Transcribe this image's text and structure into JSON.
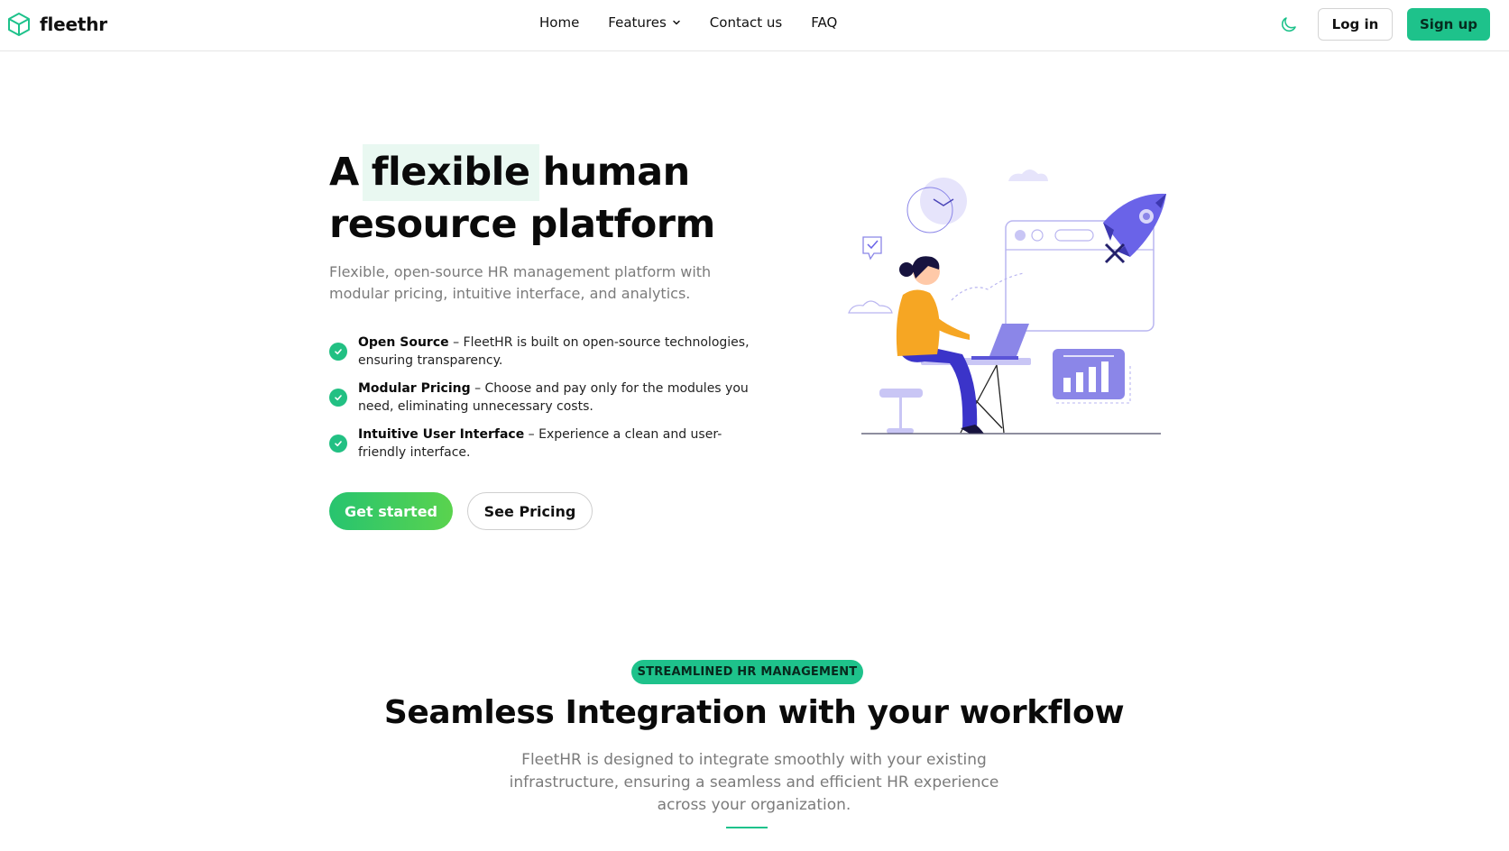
{
  "brand": {
    "name": "fleethr",
    "accent": "#1ec28b",
    "logo_icon": "cube-icon"
  },
  "nav": {
    "items": [
      {
        "label": "Home"
      },
      {
        "label": "Features",
        "icon": "chevron-down-icon"
      },
      {
        "label": "Contact us"
      },
      {
        "label": "FAQ"
      }
    ]
  },
  "header": {
    "theme_toggle_icon": "moon-icon",
    "login_label": "Log in",
    "signup_label": "Sign up"
  },
  "hero": {
    "title_pre": "A",
    "title_highlight": "flexible",
    "title_post": "human resource platform",
    "subtitle": "Flexible, open-source HR management platform with modular pricing, intuitive interface, and analytics.",
    "features": [
      {
        "title": "Open Source",
        "text": " – FleetHR is built on open-source technologies, ensuring transparency."
      },
      {
        "title": "Modular Pricing",
        "text": " – Choose and pay only for the modules you need, eliminating unnecessary costs."
      },
      {
        "title": "Intuitive User Interface",
        "text": " – Experience a clean and user-friendly interface."
      }
    ],
    "cta_primary": "Get started",
    "cta_secondary": "See Pricing"
  },
  "section": {
    "badge": "STREAMLINED HR MANAGEMENT",
    "title": "Seamless Integration with your workflow",
    "subtitle": "FleetHR is designed to integrate smoothly with your existing infrastructure, ensuring a seamless and efficient HR experience across your organization."
  },
  "illustration": {
    "name": "woman-at-laptop-illustration"
  }
}
